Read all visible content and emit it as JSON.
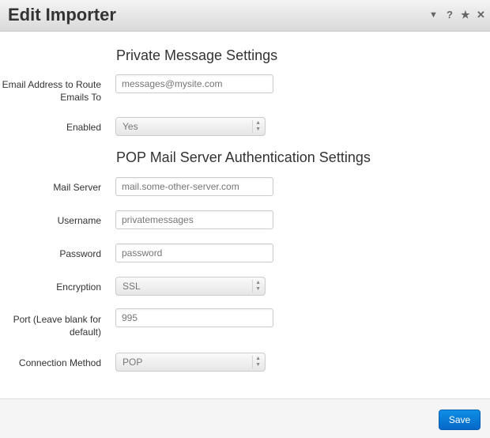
{
  "header": {
    "title": "Edit Importer",
    "icons": [
      "collapse-icon",
      "help-icon",
      "star-icon",
      "close-icon"
    ],
    "icon_glyphs": {
      "collapse": "▼",
      "help": "?",
      "star": "★",
      "close": "✕"
    }
  },
  "sections": {
    "private": "Private Message Settings",
    "pop": "POP Mail Server Authentication Settings"
  },
  "fields": {
    "email": {
      "label": "Email Address to Route Emails To",
      "placeholder": "messages@mysite.com"
    },
    "enabled": {
      "label": "Enabled",
      "value": "Yes"
    },
    "mail_server": {
      "label": "Mail Server",
      "placeholder": "mail.some-other-server.com"
    },
    "username": {
      "label": "Username",
      "placeholder": "privatemessages"
    },
    "password": {
      "label": "Password",
      "placeholder": "password"
    },
    "encryption": {
      "label": "Encryption",
      "value": "SSL"
    },
    "port": {
      "label": "Port (Leave blank for default)",
      "placeholder": "995"
    },
    "connection": {
      "label": "Connection Method",
      "value": "POP"
    }
  },
  "footer": {
    "save_label": "Save"
  },
  "colors": {
    "accent": "#0a78d6"
  }
}
